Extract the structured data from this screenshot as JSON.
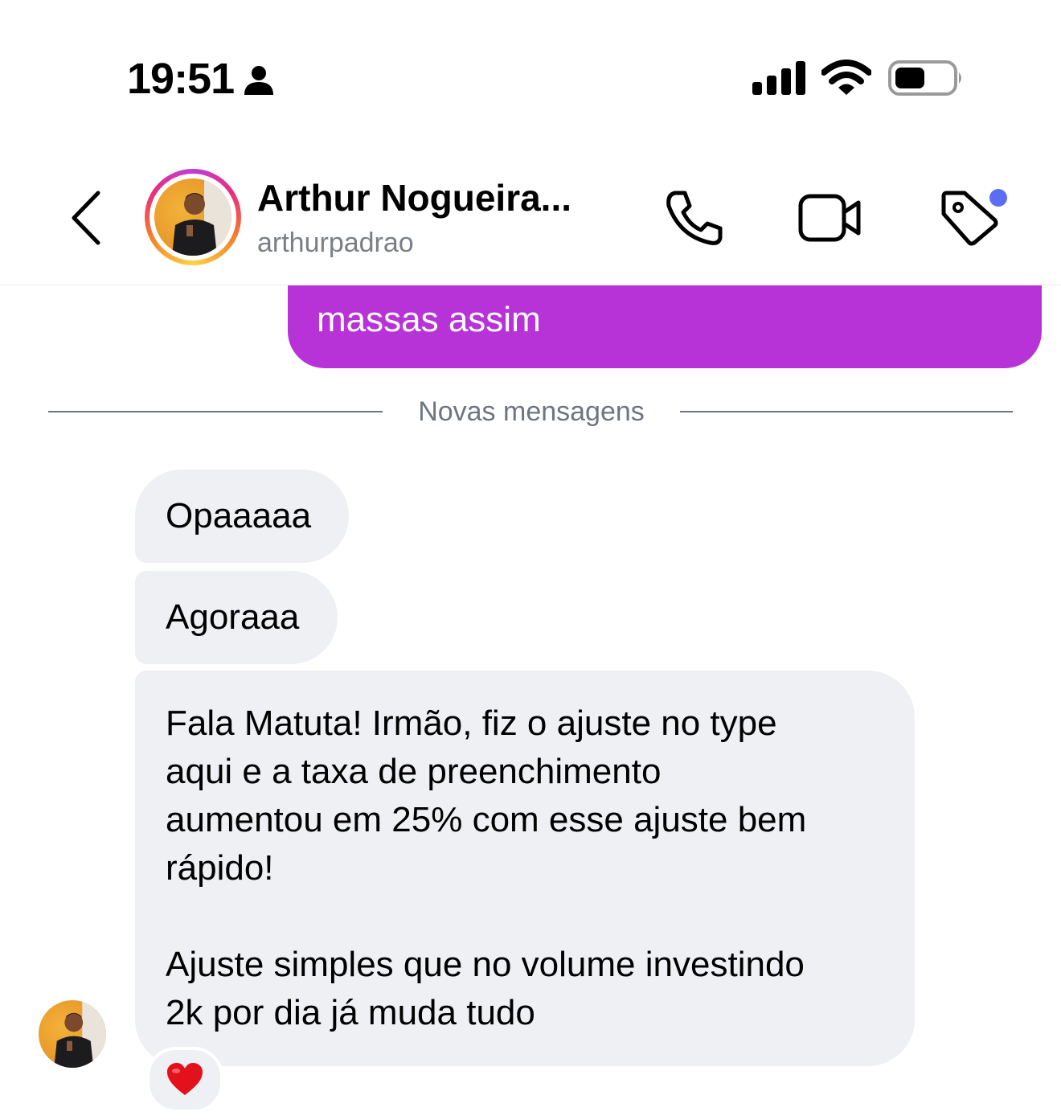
{
  "status_bar": {
    "time": "19:51"
  },
  "header": {
    "contact_name": "Arthur Nogueira...",
    "username": "arthurpadrao",
    "tag_notification_color": "#5b6cf5"
  },
  "messages": {
    "sent_partial": "massas assim",
    "divider": "Novas mensagens",
    "received": [
      "Opaaaaa",
      "Agoraaa",
      "Fala Matuta! Irmão, fiz o ajuste no type\naqui e a taxa de preenchimento\naumentou em 25% com esse ajuste bem\nrápido!\n\nAjuste simples que no volume investindo\n2k por dia já muda tudo"
    ],
    "reaction": "heart"
  },
  "colors": {
    "sent_bubble": "#b733d8",
    "received_bubble": "#eff0f4",
    "muted_text": "#6e7580"
  }
}
